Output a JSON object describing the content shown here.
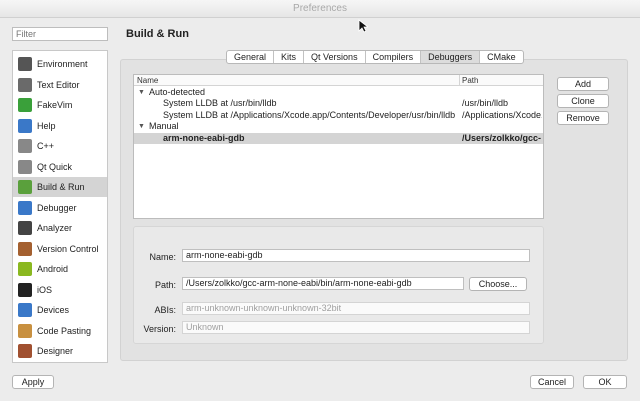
{
  "window": {
    "title": "Preferences"
  },
  "filter": {
    "placeholder": "Filter"
  },
  "sidebar": {
    "items": [
      {
        "label": "Environment",
        "icon": "monitor-icon",
        "color": "#555555"
      },
      {
        "label": "Text Editor",
        "icon": "text-editor-icon",
        "color": "#6a6a6a"
      },
      {
        "label": "FakeVim",
        "icon": "fakevim-icon",
        "color": "#3aa03a"
      },
      {
        "label": "Help",
        "icon": "help-icon",
        "color": "#3a78c8"
      },
      {
        "label": "C++",
        "icon": "cpp-icon",
        "color": "#888888"
      },
      {
        "label": "Qt Quick",
        "icon": "qt-quick-icon",
        "color": "#888888"
      },
      {
        "label": "Build & Run",
        "icon": "build-run-icon",
        "color": "#5aa03c"
      },
      {
        "label": "Debugger",
        "icon": "debugger-icon",
        "color": "#3a78c8"
      },
      {
        "label": "Analyzer",
        "icon": "analyzer-icon",
        "color": "#444444"
      },
      {
        "label": "Version Control",
        "icon": "version-control-icon",
        "color": "#a46030"
      },
      {
        "label": "Android",
        "icon": "android-icon",
        "color": "#8ab820"
      },
      {
        "label": "iOS",
        "icon": "ios-icon",
        "color": "#222222"
      },
      {
        "label": "Devices",
        "icon": "devices-icon",
        "color": "#3a78c8"
      },
      {
        "label": "Code Pasting",
        "icon": "code-pasting-icon",
        "color": "#c89040"
      },
      {
        "label": "Designer",
        "icon": "designer-icon",
        "color": "#a05030"
      }
    ],
    "selected": "Build & Run"
  },
  "page": {
    "heading": "Build & Run"
  },
  "tabs": [
    {
      "label": "General",
      "active": false
    },
    {
      "label": "Kits",
      "active": false
    },
    {
      "label": "Qt Versions",
      "active": false
    },
    {
      "label": "Compilers",
      "active": false
    },
    {
      "label": "Debuggers",
      "active": true
    },
    {
      "label": "CMake",
      "active": false
    }
  ],
  "tree": {
    "columns": {
      "name": "Name",
      "path": "Path"
    },
    "rows": [
      {
        "name": "Auto-detected",
        "path": "",
        "group": true
      },
      {
        "name": "System LLDB at /usr/bin/lldb",
        "path": "/usr/bin/lldb",
        "group": false
      },
      {
        "name": "System LLDB at /Applications/Xcode.app/Contents/Developer/usr/bin/lldb",
        "path": "/Applications/Xcode.",
        "group": false
      },
      {
        "name": "Manual",
        "path": "",
        "group": true
      },
      {
        "name": "arm-none-eabi-gdb",
        "path": "/Users/zolkko/gcc-",
        "group": false,
        "selected": true
      }
    ]
  },
  "actions": {
    "add": "Add",
    "clone": "Clone",
    "remove": "Remove"
  },
  "details": {
    "name_label": "Name:",
    "name_value": "arm-none-eabi-gdb",
    "path_label": "Path:",
    "path_value": "/Users/zolkko/gcc-arm-none-eabi/bin/arm-none-eabi-gdb",
    "choose_label": "Choose...",
    "abis_label": "ABIs:",
    "abis_value": "arm-unknown-unknown-unknown-32bit",
    "version_label": "Version:",
    "version_value": "Unknown"
  },
  "footer": {
    "apply": "Apply",
    "cancel": "Cancel",
    "ok": "OK"
  }
}
